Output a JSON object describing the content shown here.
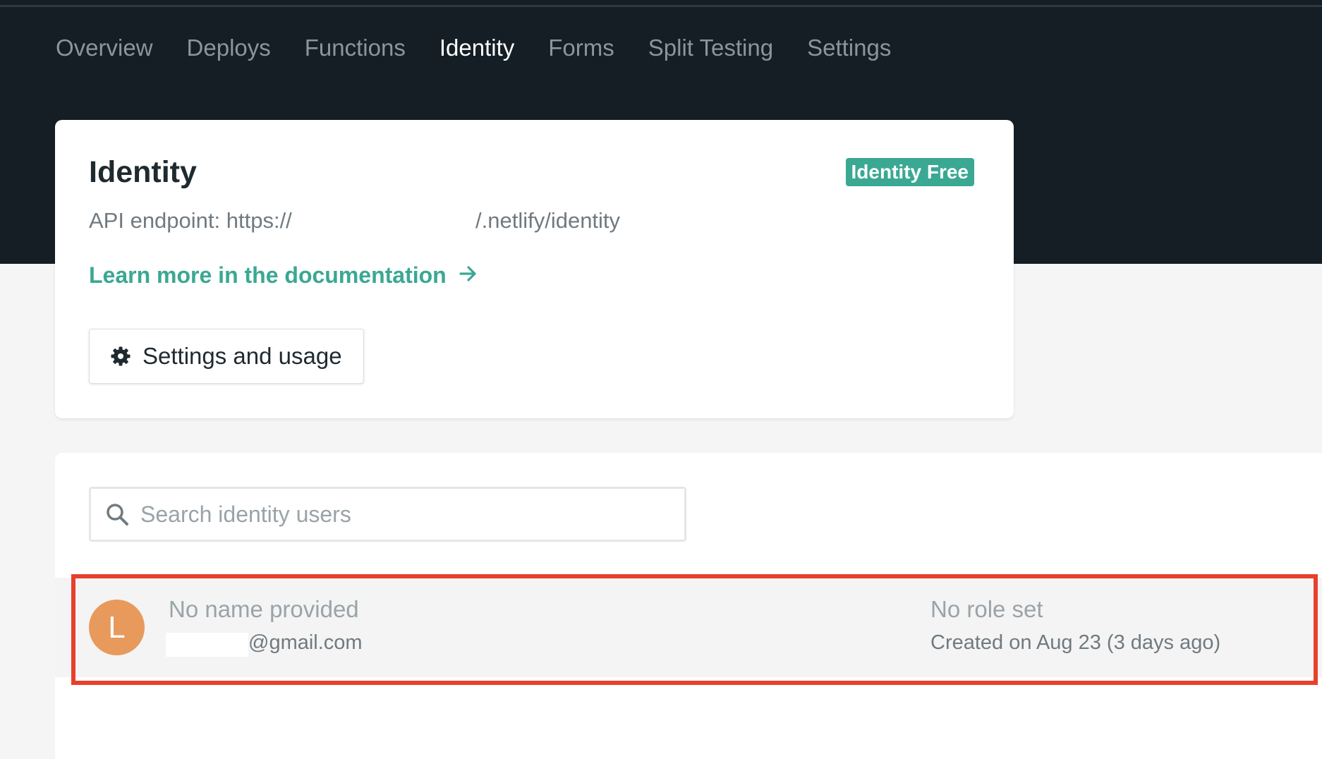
{
  "nav": {
    "tabs": [
      {
        "label": "Overview"
      },
      {
        "label": "Deploys"
      },
      {
        "label": "Functions"
      },
      {
        "label": "Identity",
        "active": true
      },
      {
        "label": "Forms"
      },
      {
        "label": "Split Testing"
      },
      {
        "label": "Settings"
      }
    ]
  },
  "identity": {
    "title": "Identity",
    "plan_badge": "Identity Free",
    "api_label": "API endpoint: https://",
    "api_suffix": "/.netlify/identity",
    "doc_link": "Learn more in the documentation",
    "doc_link_icon": "arrow-right-icon",
    "settings_button": "Settings and usage",
    "settings_icon": "gear-icon"
  },
  "users": {
    "search_placeholder": "Search identity users",
    "search_icon": "search-icon",
    "list": [
      {
        "avatar_initial": "L",
        "name": "No name provided",
        "email": "@gmail.com",
        "role": "No role set",
        "created": "Created on Aug 23 (3 days ago)"
      }
    ]
  },
  "colors": {
    "nav_background": "#141e24",
    "accent": "#3aa893",
    "avatar": "#e89a5c",
    "highlight": "#e8402c"
  }
}
